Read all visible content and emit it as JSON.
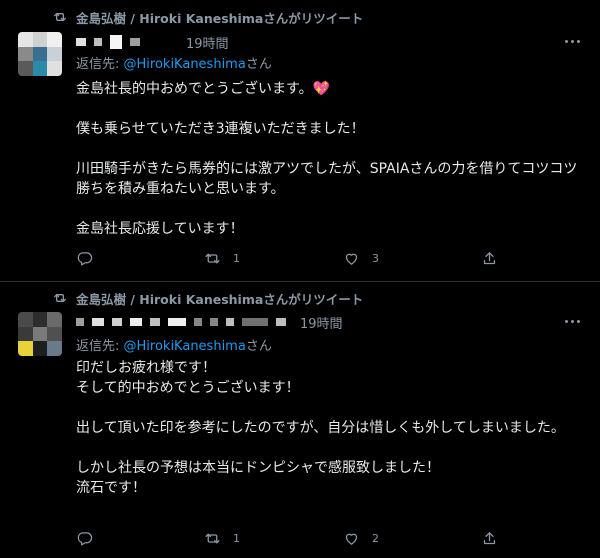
{
  "tweets": [
    {
      "retweeted_by": "金島弘樹 / Hiroki Kaneshimaさんがリツイート",
      "time": "19時間",
      "reply_prefix": "返信先: ",
      "reply_handle": "@HirokiKaneshima",
      "reply_suffix": "さん",
      "lines": [
        "金島社長的中おめでとうございます。💖",
        "",
        "僕も乗らせていただき3連複いただきました！",
        "",
        "川田騎手がきたら馬券的には激アツでしたが、SPAIAさんの力を借りてコツコツ勝ちを積み重ねたいと思います。",
        "",
        "金島社長応援しています！"
      ],
      "retweet_count": "1",
      "like_count": "3"
    },
    {
      "retweeted_by": "金島弘樹 / Hiroki Kaneshimaさんがリツイート",
      "time": "19時間",
      "reply_prefix": "返信先: ",
      "reply_handle": "@HirokiKaneshima",
      "reply_suffix": "さん",
      "lines": [
        "印だしお疲れ様です！",
        "そして的中おめでとうございます！",
        "",
        "出して頂いた印を参考にしたのですが、自分は惜しくも外してしまいました。",
        "",
        "しかし社長の予想は本当にドンピシャで感服致しました！",
        "流石です！"
      ],
      "retweet_count": "1",
      "like_count": "2"
    }
  ],
  "icons": {
    "retweet": "retweet-icon",
    "reply": "reply-icon",
    "like": "heart-icon",
    "share": "share-icon",
    "more": "more-icon"
  }
}
